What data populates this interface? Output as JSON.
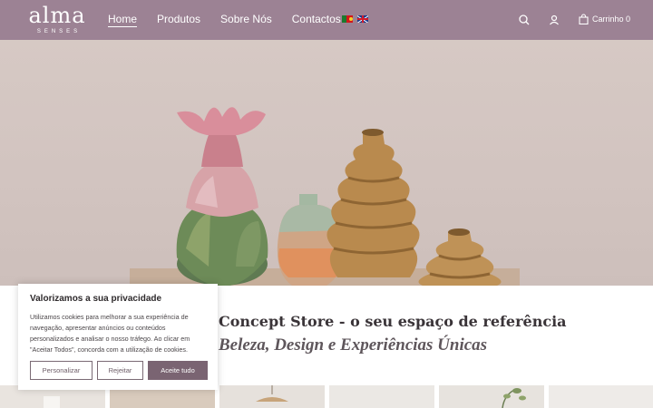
{
  "header": {
    "logo_main": "alma",
    "logo_sub": "SENSES",
    "nav": [
      {
        "label": "Home",
        "active": true
      },
      {
        "label": "Produtos",
        "active": false
      },
      {
        "label": "Sobre Nós",
        "active": false
      },
      {
        "label": "Contactos",
        "active": false
      }
    ],
    "cart_label": "Carrinho 0"
  },
  "hero": {
    "tagline": "Concept Store - o seu espaço de referência",
    "subtagline": "Beleza, Design e Experiências Únicas"
  },
  "cookie": {
    "title": "Valorizamos a sua privacidade",
    "text": "Utilizamos cookies para melhorar a sua experiência de navegação, apresentar anúncios ou conteúdos personalizados e analisar o nosso tráfego. Ao clicar em \"Aceitar Todos\", concorda com a utilização de cookies.",
    "customize_label": "Personalizar",
    "reject_label": "Rejeitar",
    "accept_label": "Aceite tudo"
  },
  "colors": {
    "header_bg": "#9c8294",
    "accent": "#7a6472"
  }
}
